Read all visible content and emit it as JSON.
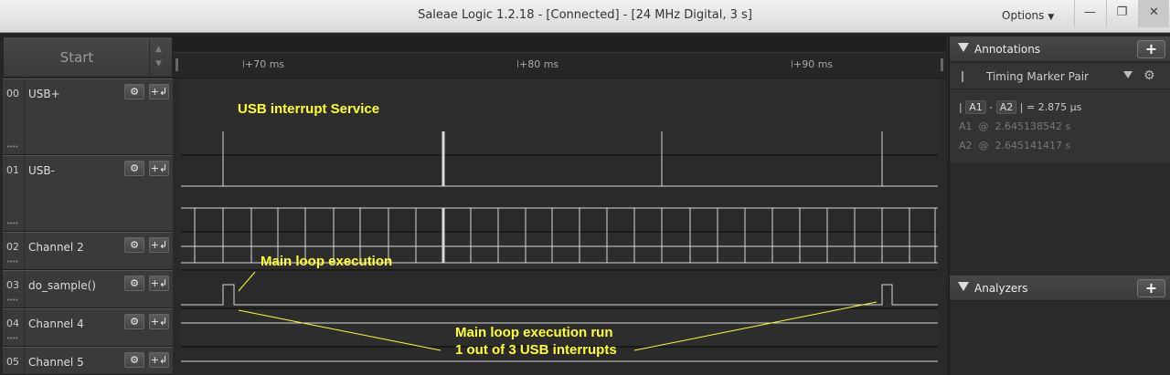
{
  "window": {
    "title": "Saleae Logic 1.2.18 - [Connected] - [24 MHz Digital, 3 s]",
    "options_label": "Options",
    "minimize_glyph": "—",
    "restore_glyph": "❐",
    "close_glyph": "✕"
  },
  "sidebar": {
    "start_label": "Start",
    "spin_up": "▲",
    "spin_down": "▼",
    "gear_glyph": "⚙",
    "trigger_glyph": "+↲",
    "grip_glyph": "••••",
    "channels": [
      {
        "index": "00",
        "name": "USB+",
        "color": "#3a3a3a"
      },
      {
        "index": "01",
        "name": "USB-",
        "color": "#8b4513"
      },
      {
        "index": "02",
        "name": "Channel 2",
        "color": "#c8141e"
      },
      {
        "index": "03",
        "name": "do_sample()",
        "color": "#e8741a"
      },
      {
        "index": "04",
        "name": "Channel 4",
        "color": "#f0c419"
      },
      {
        "index": "05",
        "name": "Channel 5",
        "color": "#4caf3a"
      }
    ]
  },
  "timeline": {
    "ticks": [
      "+70 ms",
      "+80 ms",
      "+90 ms"
    ]
  },
  "annotations_on_wave": {
    "usb_service": "USB interrupt Service",
    "main_loop": "Main loop execution",
    "run_line1": "Main loop execution run",
    "run_line2": "1 out of 3 USB interrupts",
    "color": "#ffff33"
  },
  "right_panel": {
    "annotations_label": "Annotations",
    "add_glyph": "+",
    "marker_type": "Timing Marker Pair",
    "pin_glyph": "❙",
    "gear_glyph": "⚙",
    "delta": {
      "a1": "A1",
      "dash": "-",
      "a2": "A2",
      "eq": "=",
      "value": "2.875 μs"
    },
    "a1": {
      "label": "A1",
      "at": "@",
      "value": "2.645138542 s"
    },
    "a2": {
      "label": "A2",
      "at": "@",
      "value": "2.645141417 s"
    },
    "analyzers_label": "Analyzers"
  }
}
